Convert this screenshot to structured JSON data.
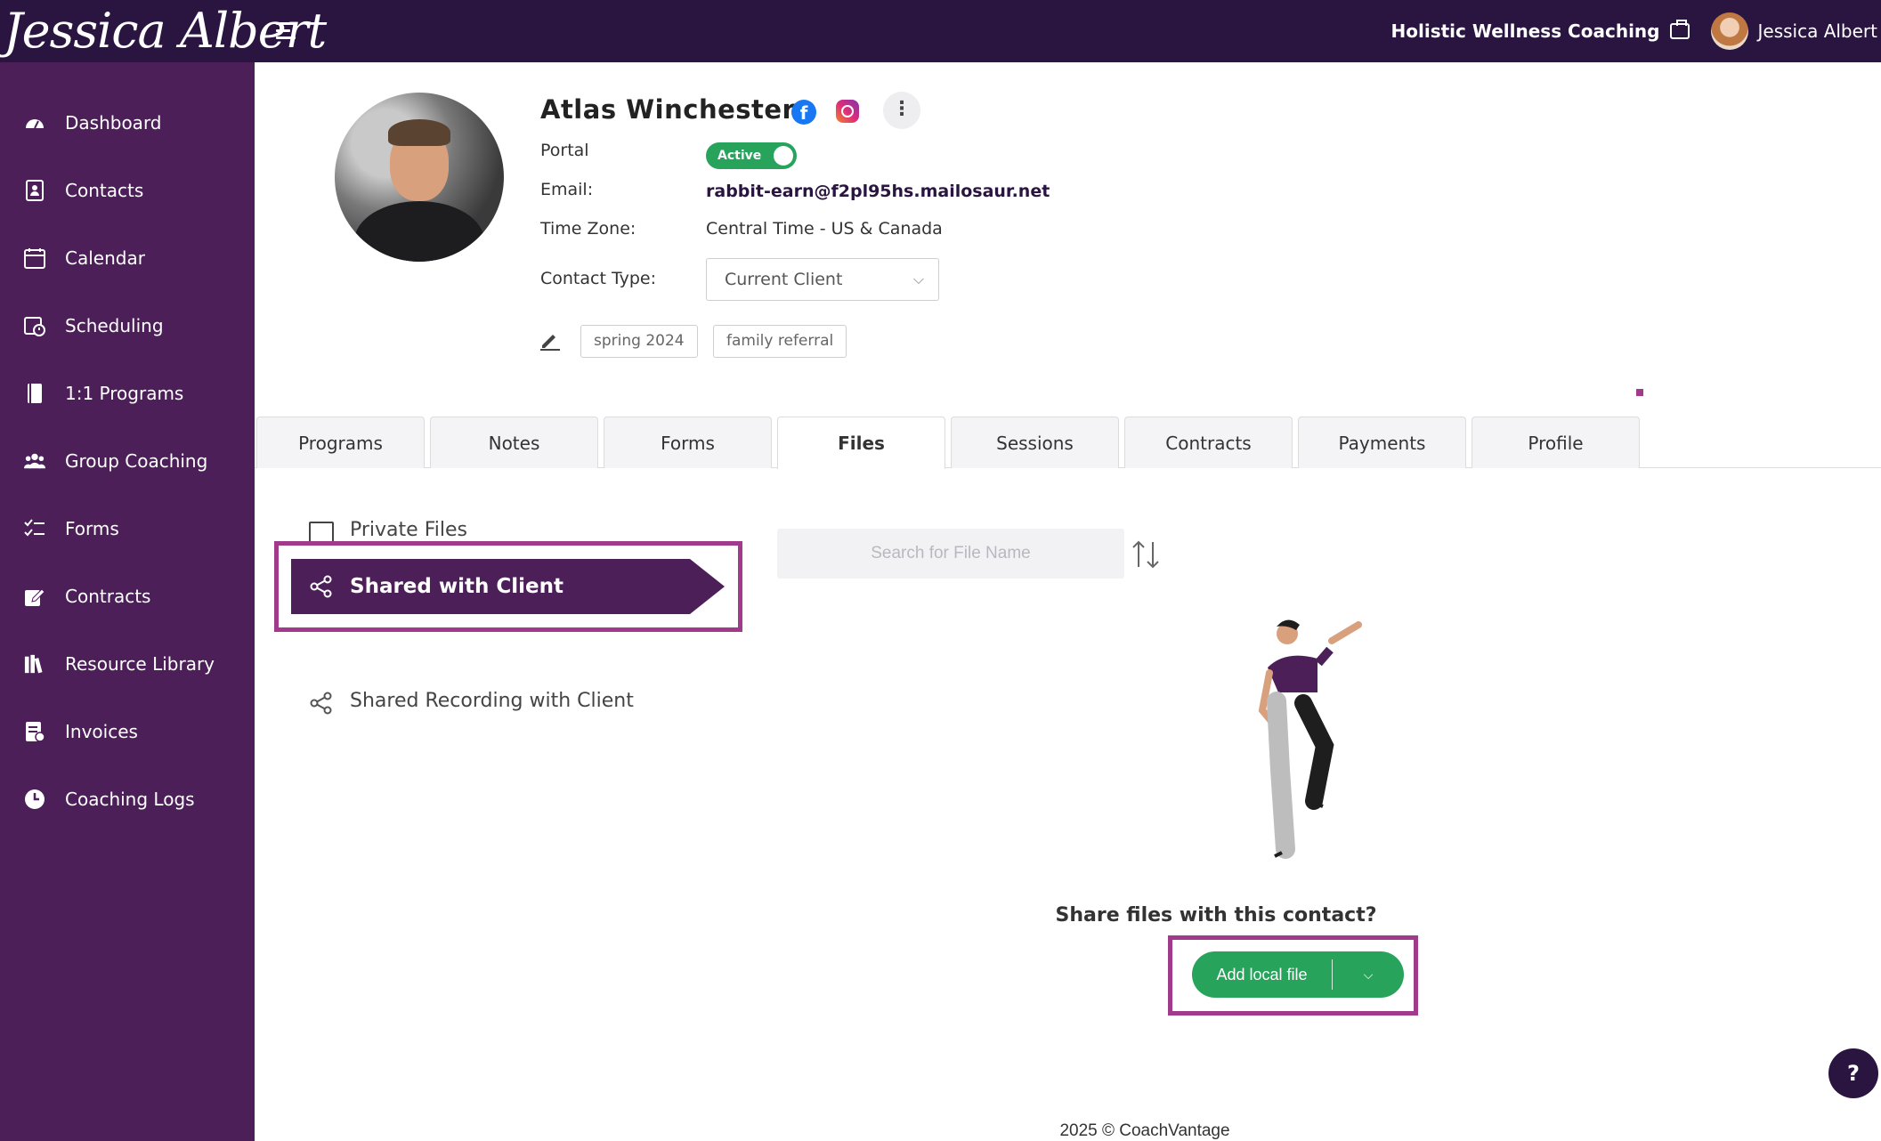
{
  "header": {
    "logo_text": "Jessica Albert",
    "company": "Holistic Wellness Coaching",
    "username": "Jessica Albert"
  },
  "sidebar": {
    "items": [
      {
        "label": "Dashboard",
        "icon": "dashboard-icon"
      },
      {
        "label": "Contacts",
        "icon": "contacts-icon"
      },
      {
        "label": "Calendar",
        "icon": "calendar-icon"
      },
      {
        "label": "Scheduling",
        "icon": "scheduling-icon"
      },
      {
        "label": "1:1 Programs",
        "icon": "book-icon"
      },
      {
        "label": "Group Coaching",
        "icon": "group-icon"
      },
      {
        "label": "Forms",
        "icon": "checklist-icon"
      },
      {
        "label": "Contracts",
        "icon": "contract-icon"
      },
      {
        "label": "Resource Library",
        "icon": "library-icon"
      },
      {
        "label": "Invoices",
        "icon": "invoice-icon"
      },
      {
        "label": "Coaching Logs",
        "icon": "clock-icon"
      }
    ]
  },
  "contact": {
    "name": "Atlas Winchester",
    "portal_label": "Portal",
    "portal_status": "Active",
    "email_label": "Email:",
    "email": "rabbit-earn@f2pl95hs.mailosaur.net",
    "timezone_label": "Time Zone:",
    "timezone": "Central Time - US & Canada",
    "type_label": "Contact Type:",
    "type_value": "Current Client",
    "tags": [
      "spring 2024",
      "family referral"
    ]
  },
  "tabs": [
    "Programs",
    "Notes",
    "Forms",
    "Files",
    "Sessions",
    "Contracts",
    "Payments",
    "Profile"
  ],
  "active_tab": "Files",
  "files": {
    "categories": [
      "Private Files",
      "Shared with Client",
      "Shared Recording with Client"
    ],
    "active_category": "Shared with Client",
    "search_placeholder": "Search for File Name",
    "empty_message": "Share files with this contact?",
    "add_button": "Add local file"
  },
  "footer": "2025 © CoachVantage",
  "help_label": "?",
  "colors": {
    "topbar": "#2a1440",
    "sidebar": "#4c1f59",
    "accent_green": "#27a35b",
    "highlight_border": "#a23a8b"
  }
}
